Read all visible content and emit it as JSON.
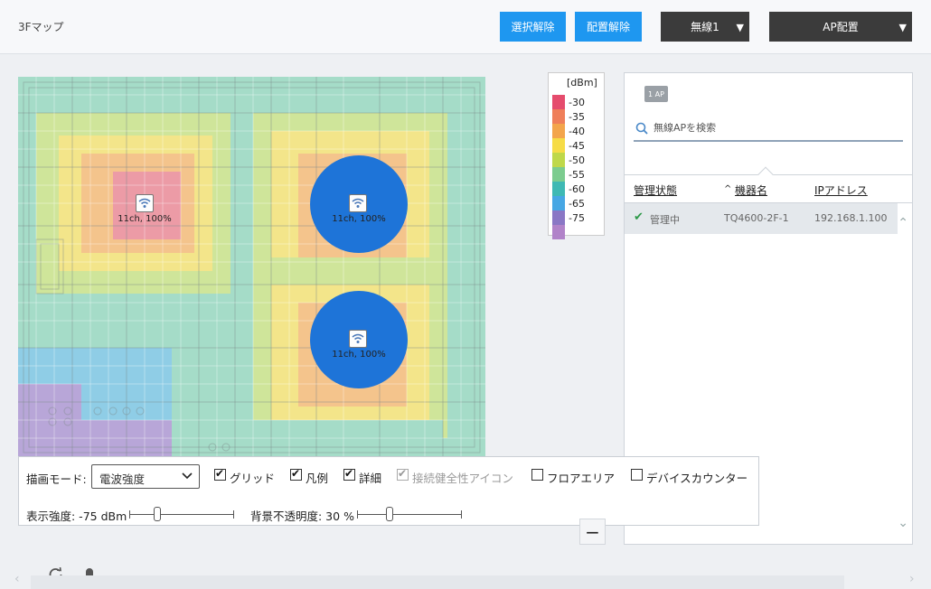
{
  "header": {
    "title": "3Fマップ",
    "deselect_label": "選択解除",
    "unplace_label": "配置解除",
    "wireless_select": "無線1",
    "ap_place_select": "AP配置"
  },
  "legend": {
    "title": "[dBm]",
    "items": [
      {
        "value": "-30",
        "color": "#e54c6d"
      },
      {
        "value": "-35",
        "color": "#ef7f5a"
      },
      {
        "value": "-40",
        "color": "#f3a54c"
      },
      {
        "value": "-45",
        "color": "#f6dc47"
      },
      {
        "value": "-50",
        "color": "#bfd84a"
      },
      {
        "value": "-55",
        "color": "#7ccc8f"
      },
      {
        "value": "-60",
        "color": "#3fb9b4"
      },
      {
        "value": "-65",
        "color": "#47a7e4"
      },
      {
        "value": "-75",
        "color": "#8a77c5"
      },
      {
        "value": "",
        "color": "#b183c9"
      }
    ]
  },
  "map": {
    "access_points": [
      {
        "label": "11ch, 100%"
      },
      {
        "label": "11ch, 100%"
      },
      {
        "label": "11ch, 100%"
      }
    ]
  },
  "panel": {
    "ap_count": "1 AP",
    "search_placeholder": "無線APを検索",
    "columns": {
      "status": "管理状態",
      "device": "機器名",
      "ip": "IPアドレス"
    },
    "sort_indicator": "^",
    "rows": [
      {
        "status": "管理中",
        "device": "TQ4600-2F-1",
        "ip": "192.168.1.100"
      }
    ]
  },
  "controls": {
    "mode_label": "描画モード:",
    "mode_value": "電波強度",
    "grid_label": "グリッド",
    "legend_label": "凡例",
    "detail_label": "詳細",
    "health_label": "接続健全性アイコン",
    "floor_area_label": "フロアエリア",
    "device_counter_label": "デバイスカウンター",
    "strength_label": "表示強度: -75 dBm",
    "strength_fraction": 0.25,
    "opacity_label": "背景不透明度: 30 %",
    "opacity_fraction": 0.3,
    "checked": {
      "grid": true,
      "legend": true,
      "detail": true,
      "health": true,
      "floor_area": false,
      "device_counter": false
    }
  },
  "colors": {
    "accent": "#1e97f0",
    "dark_button": "#3b3b3b",
    "ap_circle": "#1e74d8"
  }
}
